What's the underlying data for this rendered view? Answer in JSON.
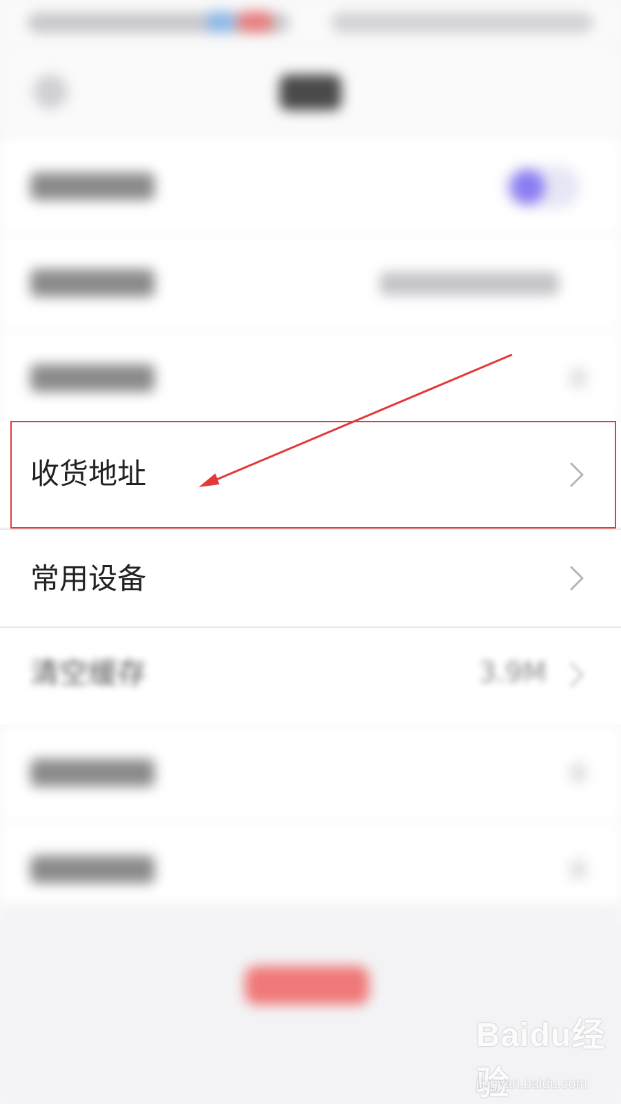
{
  "settings": {
    "shipping_address": {
      "label": "收货地址"
    },
    "common_devices": {
      "label": "常用设备"
    },
    "clear_cache": {
      "label": "清空缓存",
      "size": "3.9M"
    }
  },
  "annotation": {
    "color": "#e23a3a"
  },
  "toggle": {
    "state": "on",
    "accent": "#8a7df2"
  },
  "watermark": {
    "brand": "Baidu经验",
    "url": "jingyan.baidu.com"
  }
}
